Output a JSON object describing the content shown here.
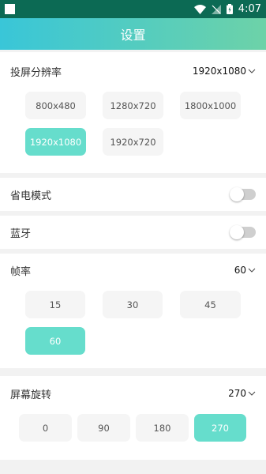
{
  "status_bar": {
    "time": "4:07"
  },
  "title": "设置",
  "resolution": {
    "label": "投屏分辨率",
    "selected": "1920x1080",
    "options": [
      "800x480",
      "1280x720",
      "1800x1000",
      "1920x1080",
      "1920x720"
    ]
  },
  "power_saving": {
    "label": "省电模式",
    "enabled": false
  },
  "bluetooth": {
    "label": "蓝牙",
    "enabled": false
  },
  "frame_rate": {
    "label": "帧率",
    "selected": "60",
    "options": [
      "15",
      "30",
      "45",
      "60"
    ]
  },
  "rotation": {
    "label": "屏幕旋转",
    "selected": "270",
    "options": [
      "0",
      "90",
      "180",
      "270"
    ]
  },
  "colors": {
    "accent": "#66ddcc",
    "status_bar": "#0c6a54",
    "gradient_start": "#39c6d8",
    "gradient_end": "#6dd2a8"
  }
}
